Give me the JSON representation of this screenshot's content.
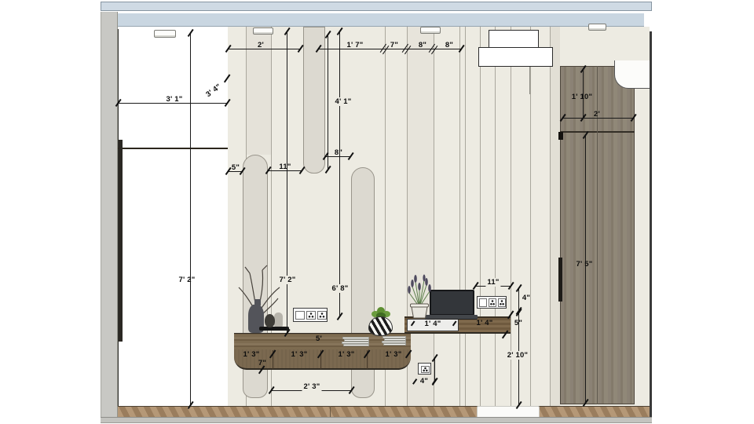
{
  "meta": {
    "drawing_type": "interior elevation with dimensions"
  },
  "palette": {
    "ceiling_blue": "#c9d6e1",
    "wall_cream": "#edebe2",
    "slat_wood": "#8a7355",
    "console_wood": "#7b6950",
    "wardrobe_gray": "#877e70",
    "floor_wood": "#a88a68",
    "annotation": "#111111"
  },
  "labels": {
    "top": {
      "a": "2'",
      "b": "1' 7\"",
      "c": "7\"",
      "d": "8\"",
      "e": "8\""
    },
    "left_wardrobe": {
      "diag": "3' 4\"",
      "width": "3' 1\"",
      "height": "7' 2\""
    },
    "wall": {
      "gap5": "5\"",
      "gap11": "11\"",
      "gap8": "8\"",
      "groove": "4' 1\"",
      "h72": "7' 2\"",
      "h68": "6' 8\""
    },
    "console": {
      "top": "5'",
      "d1": "1' 3\"",
      "d2": "1' 3\"",
      "d3": "1' 3\"",
      "d4": "1' 3\"",
      "gap7": "7\"",
      "w23": "2' 3\""
    },
    "desk": {
      "tray": "1' 4\"",
      "shelf": "1' 4\"",
      "thick": "5\"",
      "socket_w": "11\"",
      "socket_h": "4\"",
      "height": "2' 10\"",
      "small_socket": "4\""
    },
    "right_wardrobe": {
      "top_h": "1' 10\"",
      "top_w": "2'",
      "height": "7' 5\""
    }
  }
}
